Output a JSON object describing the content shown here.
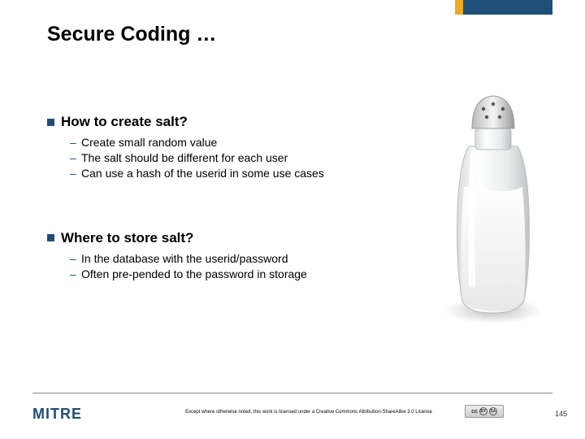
{
  "title": "Secure Coding …",
  "sections": [
    {
      "heading": "How to create salt?",
      "items": [
        "Create small random value",
        "The salt should be different for each user",
        "Can use a hash of the userid in some use cases"
      ]
    },
    {
      "heading": "Where to store salt?",
      "items": [
        "In the database with the userid/password",
        "Often pre-pended to the password in storage"
      ]
    }
  ],
  "footer": {
    "logo": "MITRE",
    "license_text": "Except where otherwise noted, this work is licensed under a Creative Commons Attribution-ShareAlike 3.0 License",
    "cc_label": "cc",
    "page_number": "145"
  },
  "image_alt": "salt-shaker"
}
